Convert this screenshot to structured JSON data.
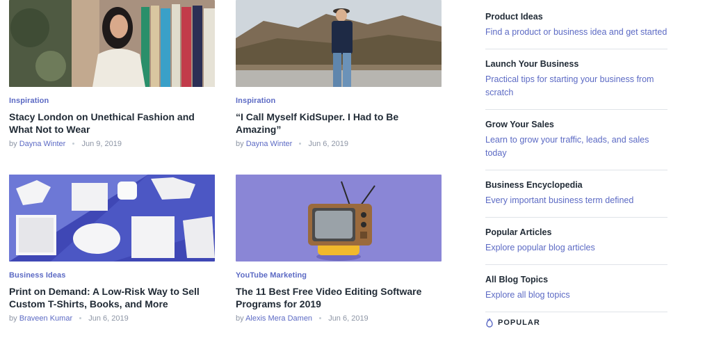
{
  "articles": [
    {
      "category": "Inspiration",
      "title": "Stacy London on Unethical Fashion and What Not to Wear",
      "by": "by",
      "author": "Dayna Winter",
      "date": "Jun 9, 2019"
    },
    {
      "category": "Inspiration",
      "title": "“I Call Myself KidSuper. I Had to Be Amazing”",
      "by": "by",
      "author": "Dayna Winter",
      "date": "Jun 6, 2019"
    },
    {
      "category": "Business Ideas",
      "title": "Print on Demand: A Low-Risk Way to Sell Custom T-Shirts, Books, and More",
      "by": "by",
      "author": "Braveen Kumar",
      "date": "Jun 6, 2019"
    },
    {
      "category": "YouTube Marketing",
      "title": "The 11 Best Free Video Editing Software Programs for 2019",
      "by": "by",
      "author": "Alexis Mera Damen",
      "date": "Jun 6, 2019"
    }
  ],
  "sidebar": {
    "items": [
      {
        "heading": "Product Ideas",
        "desc": "Find a product or business idea and get started"
      },
      {
        "heading": "Launch Your Business",
        "desc": "Practical tips for starting your business from scratch"
      },
      {
        "heading": "Grow Your Sales",
        "desc": "Learn to grow your traffic, leads, and sales today"
      },
      {
        "heading": "Business Encyclopedia",
        "desc": "Every important business term defined"
      },
      {
        "heading": "Popular Articles",
        "desc": "Explore popular blog articles"
      },
      {
        "heading": "All Blog Topics",
        "desc": "Explore all blog topics"
      }
    ],
    "popular_label": "POPULAR",
    "popular_icon": "flame-icon"
  },
  "colors": {
    "accent": "#5c6ac4",
    "text": "#212b36",
    "muted": "#8d95a5"
  }
}
